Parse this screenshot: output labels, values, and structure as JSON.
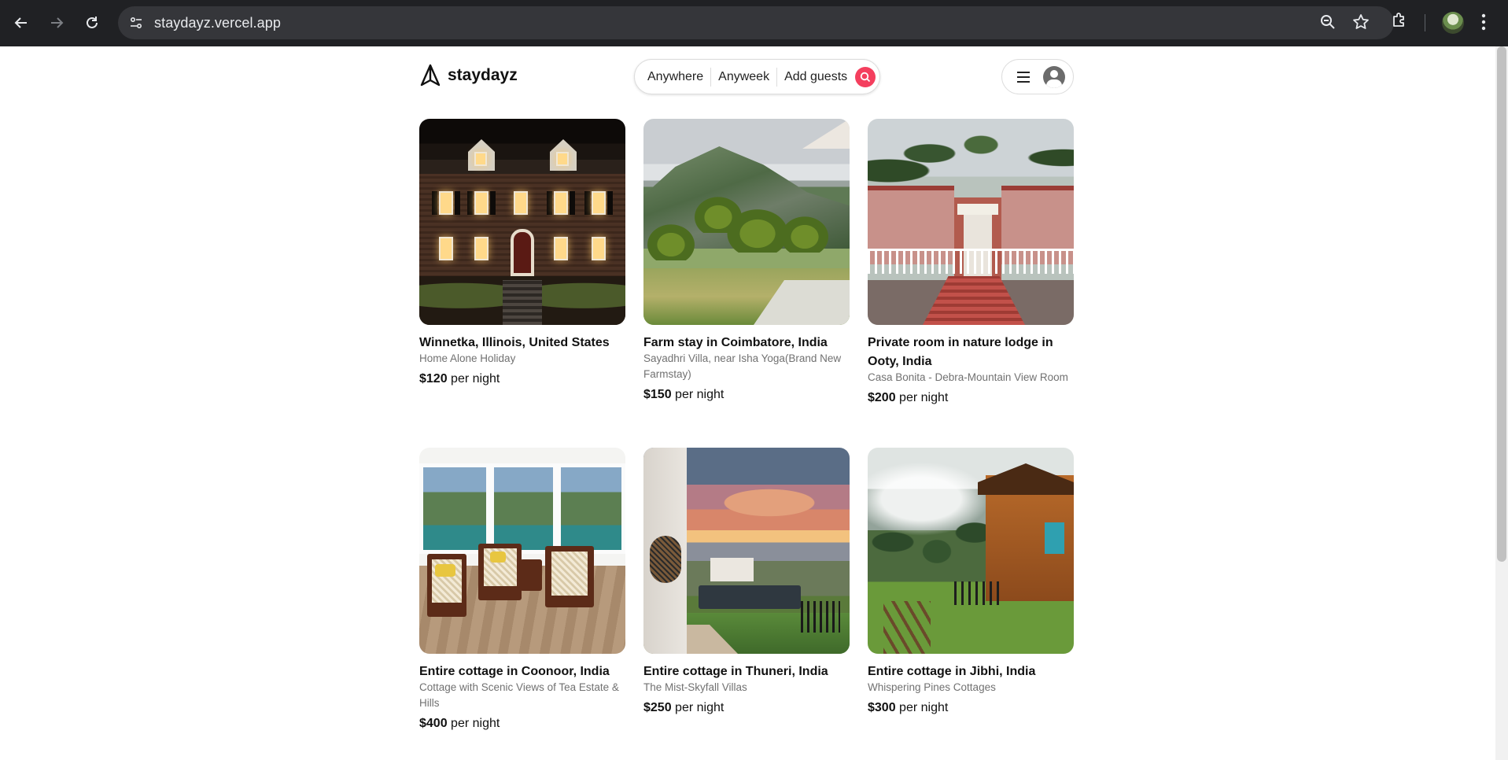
{
  "browser": {
    "url": "staydayz.vercel.app",
    "icons": {
      "back": "arrow-left-icon",
      "forward": "arrow-right-icon",
      "reload": "reload-icon",
      "site_info": "tune-icon",
      "zoom": "zoom-icon",
      "bookmark": "star-icon",
      "extensions": "puzzle-icon",
      "profile": "profile-avatar",
      "menu": "kebab-menu-icon"
    }
  },
  "header": {
    "brand": "staydayz",
    "search": {
      "where": "Anywhere",
      "when": "Anyweek",
      "who": "Add guests"
    },
    "accent_color": "#f43f5e"
  },
  "listings": [
    {
      "title": "Winnetka, Illinois, United States",
      "subtitle": "Home Alone Holiday",
      "price": "$120",
      "unit": "per night"
    },
    {
      "title": "Farm stay in Coimbatore, India",
      "subtitle": "Sayadhri Villa, near Isha Yoga(Brand New Farmstay)",
      "price": "$150",
      "unit": "per night"
    },
    {
      "title": "Private room in nature lodge in Ooty, India",
      "subtitle": "Casa Bonita - Debra-Mountain View Room",
      "price": "$200",
      "unit": "per night"
    },
    {
      "title": "Entire cottage in Coonoor, India",
      "subtitle": "Cottage with Scenic Views of Tea Estate & Hills",
      "price": "$400",
      "unit": "per night"
    },
    {
      "title": "Entire cottage in Thuneri, India",
      "subtitle": "The Mist-Skyfall Villas",
      "price": "$250",
      "unit": "per night"
    },
    {
      "title": "Entire cottage in Jibhi, India",
      "subtitle": "Whispering Pines Cottages",
      "price": "$300",
      "unit": "per night"
    }
  ]
}
